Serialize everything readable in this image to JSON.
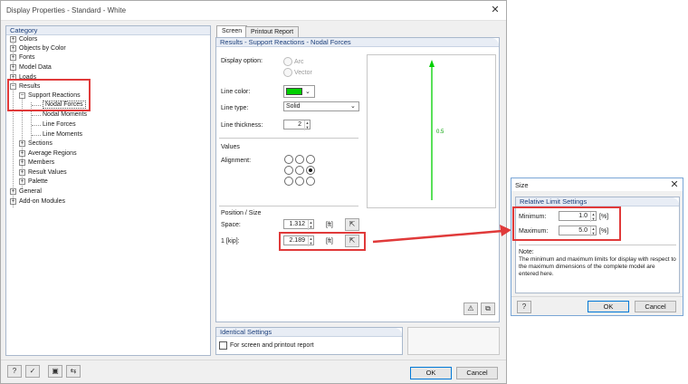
{
  "main": {
    "title": "Display Properties - Standard - White",
    "category_header": "Category",
    "tree": [
      {
        "label": "Colors"
      },
      {
        "label": "Objects by Color"
      },
      {
        "label": "Fonts"
      },
      {
        "label": "Model Data"
      },
      {
        "label": "Loads"
      },
      {
        "label": "Results"
      },
      {
        "label": "Support Reactions"
      },
      {
        "label": "Nodal Forces"
      },
      {
        "label": "Nodal Moments"
      },
      {
        "label": "Line Forces"
      },
      {
        "label": "Line Moments"
      },
      {
        "label": "Sections"
      },
      {
        "label": "Average Regions"
      },
      {
        "label": "Members"
      },
      {
        "label": "Result Values"
      },
      {
        "label": "Palette"
      },
      {
        "label": "General"
      },
      {
        "label": "Add-on Modules"
      }
    ],
    "tabs": [
      {
        "label": "Screen"
      },
      {
        "label": "Printout Report"
      }
    ],
    "section_header": "Results - Support Reactions - Nodal Forces",
    "display_option_label": "Display option:",
    "display_option_arc": "Arc",
    "display_option_vector": "Vector",
    "line_color_label": "Line color:",
    "line_color_value": "#00d000",
    "line_type_label": "Line type:",
    "line_type_value": "Solid",
    "line_thickness_label": "Line thickness:",
    "line_thickness_value": "2",
    "values_label": "Values",
    "alignment_label": "Alignment:",
    "position_size_label": "Position / Size",
    "space_label": "Space:",
    "space_value": "1.312",
    "space_unit": "[ft]",
    "kip_label": "1 [kip]:",
    "kip_value": "2.189",
    "kip_unit": "[ft]",
    "preview_value": "0.5",
    "identical_header": "Identical Settings",
    "identical_checkbox": "For screen and printout report",
    "ok": "OK",
    "cancel": "Cancel"
  },
  "size_dialog": {
    "title": "Size",
    "section_header": "Relative Limit Settings",
    "minimum_label": "Minimum:",
    "minimum_value": "1.0",
    "maximum_label": "Maximum:",
    "maximum_value": "5.0",
    "unit": "[%]",
    "note_label": "Note:",
    "note_text": "The minimum and maximum limits for display with respect to the maximum dimensions of the complete model are entered here.",
    "ok": "OK",
    "cancel": "Cancel"
  },
  "colors": {
    "highlight_red": "#e03a3a",
    "line_green": "#00d000"
  }
}
